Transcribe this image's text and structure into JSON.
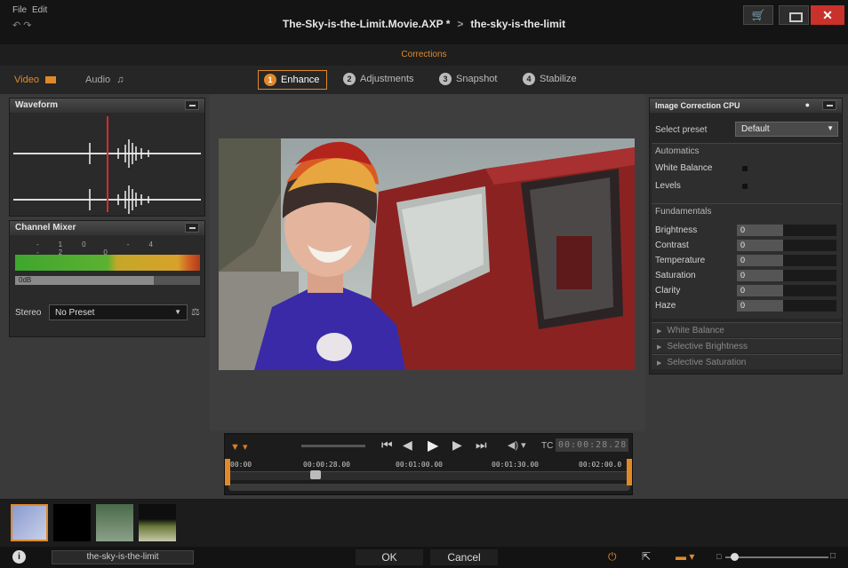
{
  "titlebar": {
    "menu_file": "File",
    "menu_edit": "Edit",
    "undo_redo": "↶ ↷",
    "project": "The-Sky-is-the-Limit.Movie.AXP *",
    "separator": ">",
    "clip": "the-sky-is-the-limit",
    "cart_glyph": "🛒",
    "close_glyph": "✕"
  },
  "corrections": {
    "label": "Corrections"
  },
  "media_tabs": {
    "video": "Video",
    "audio": "Audio"
  },
  "tabs": [
    {
      "num": "1",
      "label": "Enhance",
      "active": true
    },
    {
      "num": "2",
      "label": "Adjustments"
    },
    {
      "num": "3",
      "label": "Snapshot"
    },
    {
      "num": "4",
      "label": "Stabilize"
    }
  ],
  "waveform": {
    "title": "Waveform"
  },
  "mixer": {
    "title": "Channel Mixer",
    "scale": "-10 -4 -2 0",
    "balance": "0dB",
    "stereo_label": "Stereo",
    "preset": "No Preset"
  },
  "transport": {
    "tc_label": "TC",
    "timecode": "00:00:28.28",
    "ticks": [
      "00:00",
      "00:00:28.00",
      "00:01:00.00",
      "00:01:30.00",
      "00:02:00.0"
    ]
  },
  "image_correction": {
    "title": "Image Correction CPU",
    "select_preset_label": "Select preset",
    "preset_value": "Default",
    "automatics": {
      "title": "Automatics",
      "items": [
        "White Balance",
        "Levels"
      ]
    },
    "fundamentals": {
      "title": "Fundamentals",
      "items": [
        {
          "label": "Brightness",
          "value": "0"
        },
        {
          "label": "Contrast",
          "value": "0"
        },
        {
          "label": "Temperature",
          "value": "0"
        },
        {
          "label": "Saturation",
          "value": "0"
        },
        {
          "label": "Clarity",
          "value": "0"
        },
        {
          "label": "Haze",
          "value": "0"
        }
      ]
    },
    "collapsed_sections": [
      "White Balance",
      "Selective Brightness",
      "Selective Saturation"
    ]
  },
  "footer": {
    "info": "i",
    "filename": "the-sky-is-the-limit",
    "ok": "OK",
    "cancel": "Cancel"
  },
  "colors": {
    "accent": "#e0892a",
    "close": "#c8322a",
    "playhead": "#d82a2a"
  }
}
